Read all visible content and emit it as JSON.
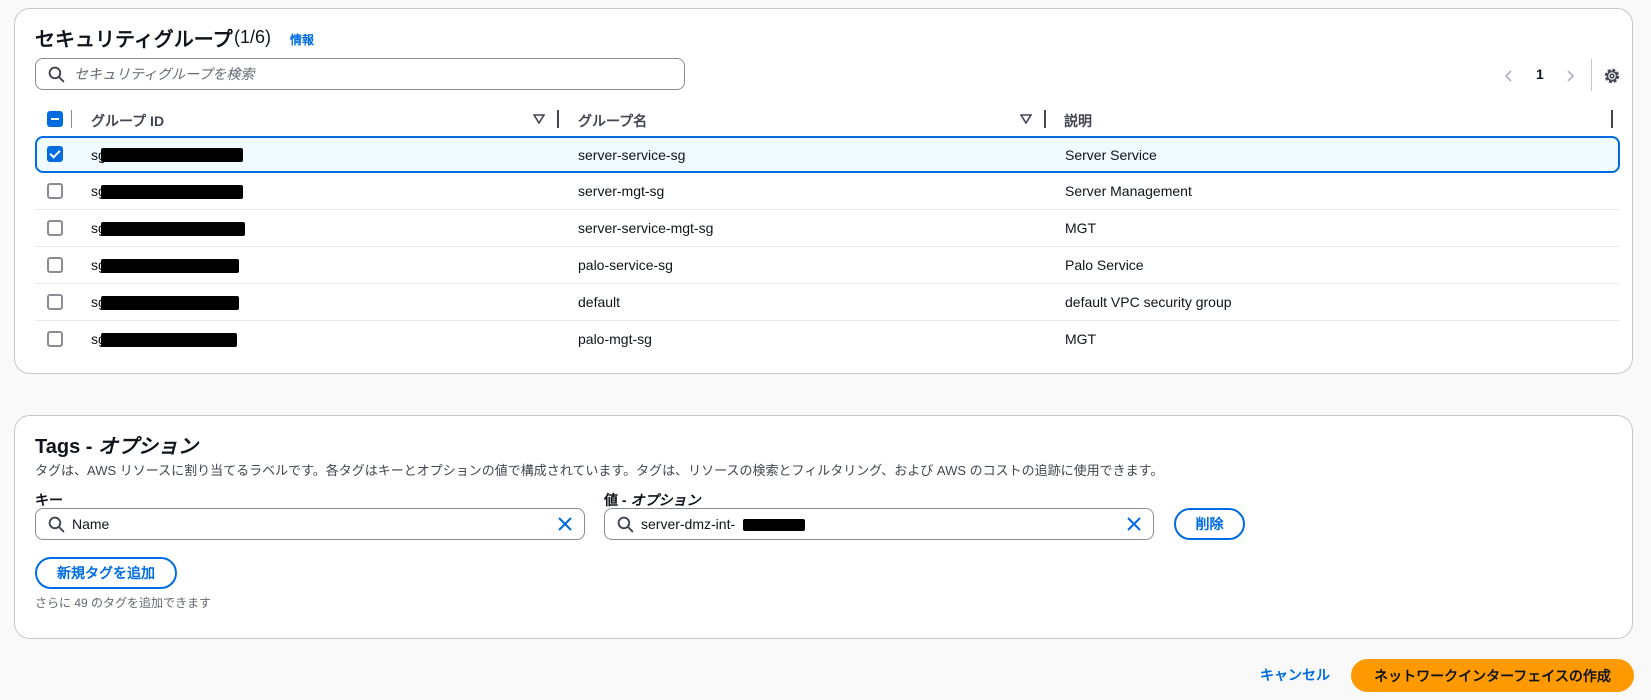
{
  "security_groups": {
    "title": "セキュリティグループ",
    "count": "(1/6)",
    "info_link": "情報",
    "search_placeholder": "セキュリティグループを検索",
    "page": "1",
    "columns": [
      "グループ ID",
      "グループ名",
      "説明"
    ],
    "rows": [
      {
        "id": "sg-",
        "name": "server-service-sg",
        "description": "Server Service",
        "selected": true
      },
      {
        "id": "sg-",
        "name": "server-mgt-sg",
        "description": "Server Management",
        "selected": false
      },
      {
        "id": "sg-",
        "name": "server-service-mgt-sg",
        "description": "MGT",
        "selected": false
      },
      {
        "id": "sg-",
        "name": "palo-service-sg",
        "description": "Palo Service",
        "selected": false
      },
      {
        "id": "sg-",
        "name": "default",
        "description": "default VPC security group",
        "selected": false
      },
      {
        "id": "sg-",
        "name": "palo-mgt-sg",
        "description": "MGT",
        "selected": false
      }
    ]
  },
  "tags": {
    "title": "Tags - ",
    "title_optional": "オプション",
    "description": "タグは、AWS リソースに割り当てるラベルです。各タグはキーとオプションの値で構成されています。タグは、リソースの検索とフィルタリング、および AWS のコストの追跡に使用できます。",
    "key_label": "キー",
    "value_label": "値 - ",
    "value_label_optional": "オプション",
    "key_value": "Name",
    "value_value": "server-dmz-int-",
    "remove_button": "削除",
    "add_button": "新規タグを追加",
    "remaining_hint": "さらに 49 のタグを追加できます"
  },
  "footer": {
    "cancel": "キャンセル",
    "create": "ネットワークインターフェイスの作成"
  },
  "colors": {
    "accent": "#006ce0",
    "primary_button": "#ff9900"
  },
  "icons": [
    "search-icon",
    "chevron-left-icon",
    "chevron-right-icon",
    "settings-gear-icon",
    "sort-caret-icon",
    "clear-x-icon",
    "checkbox-icon"
  ]
}
